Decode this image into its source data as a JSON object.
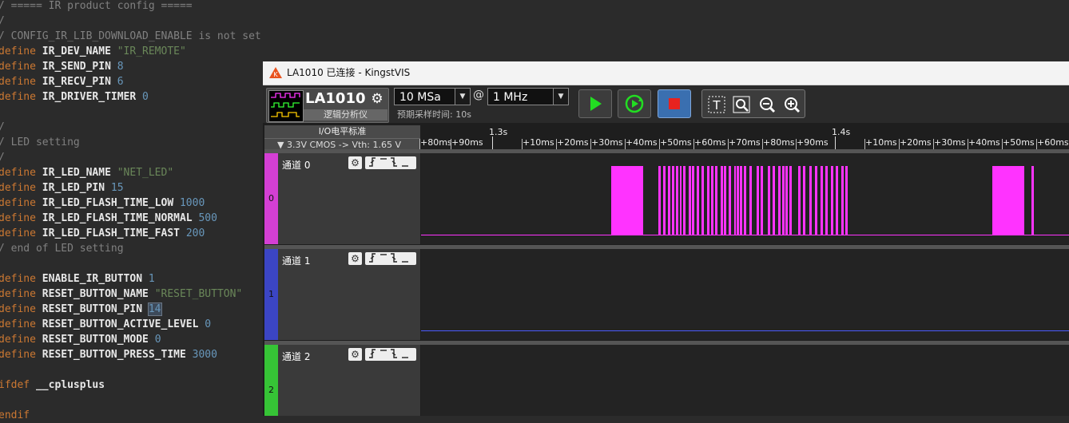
{
  "editor": {
    "lines": [
      [
        {
          "t": "/ ===== IR product config =====",
          "c": "cmt"
        }
      ],
      [
        {
          "t": "/",
          "c": "cmt"
        }
      ],
      [
        {
          "t": "/ CONFIG_IR_LIB_DOWNLOAD_ENABLE is not set",
          "c": "cmt"
        }
      ],
      [
        {
          "t": "define ",
          "c": "kw"
        },
        {
          "t": "IR_DEV_NAME ",
          "c": "id"
        },
        {
          "t": "\"IR_REMOTE\"",
          "c": "str"
        }
      ],
      [
        {
          "t": "define ",
          "c": "kw"
        },
        {
          "t": "IR_SEND_PIN ",
          "c": "id"
        },
        {
          "t": "8",
          "c": "num"
        }
      ],
      [
        {
          "t": "define ",
          "c": "kw"
        },
        {
          "t": "IR_RECV_PIN ",
          "c": "id"
        },
        {
          "t": "6",
          "c": "num"
        }
      ],
      [
        {
          "t": "define ",
          "c": "kw"
        },
        {
          "t": "IR_DRIVER_TIMER ",
          "c": "id"
        },
        {
          "t": "0",
          "c": "num"
        }
      ],
      [
        {
          "t": "",
          "c": "cmt"
        }
      ],
      [
        {
          "t": "/",
          "c": "cmt"
        }
      ],
      [
        {
          "t": "/ LED setting",
          "c": "cmt"
        }
      ],
      [
        {
          "t": "/",
          "c": "cmt"
        }
      ],
      [
        {
          "t": "define ",
          "c": "kw"
        },
        {
          "t": "IR_LED_NAME ",
          "c": "id"
        },
        {
          "t": "\"NET_LED\"",
          "c": "str"
        }
      ],
      [
        {
          "t": "define ",
          "c": "kw"
        },
        {
          "t": "IR_LED_PIN ",
          "c": "id"
        },
        {
          "t": "15",
          "c": "num"
        }
      ],
      [
        {
          "t": "define ",
          "c": "kw"
        },
        {
          "t": "IR_LED_FLASH_TIME_LOW ",
          "c": "id"
        },
        {
          "t": "1000",
          "c": "num"
        }
      ],
      [
        {
          "t": "define ",
          "c": "kw"
        },
        {
          "t": "IR_LED_FLASH_TIME_NORMAL ",
          "c": "id"
        },
        {
          "t": "500",
          "c": "num"
        }
      ],
      [
        {
          "t": "define ",
          "c": "kw"
        },
        {
          "t": "IR_LED_FLASH_TIME_FAST ",
          "c": "id"
        },
        {
          "t": "200",
          "c": "num"
        }
      ],
      [
        {
          "t": "/ end of LED setting",
          "c": "cmt"
        }
      ],
      [
        {
          "t": "",
          "c": "cmt"
        }
      ],
      [
        {
          "t": "define ",
          "c": "kw"
        },
        {
          "t": "ENABLE_IR_BUTTON ",
          "c": "id"
        },
        {
          "t": "1",
          "c": "num"
        }
      ],
      [
        {
          "t": "define ",
          "c": "kw"
        },
        {
          "t": "RESET_BUTTON_NAME ",
          "c": "id"
        },
        {
          "t": "\"RESET_BUTTON\"",
          "c": "str"
        }
      ],
      [
        {
          "t": "define ",
          "c": "kw"
        },
        {
          "t": "RESET_BUTTON_PIN ",
          "c": "id"
        },
        {
          "t": "14",
          "c": "curnum"
        }
      ],
      [
        {
          "t": "define ",
          "c": "kw"
        },
        {
          "t": "RESET_BUTTON_ACTIVE_LEVEL ",
          "c": "id"
        },
        {
          "t": "0",
          "c": "num"
        }
      ],
      [
        {
          "t": "define ",
          "c": "kw"
        },
        {
          "t": "RESET_BUTTON_MODE ",
          "c": "id"
        },
        {
          "t": "0",
          "c": "num"
        }
      ],
      [
        {
          "t": "define ",
          "c": "kw"
        },
        {
          "t": "RESET_BUTTON_PRESS_TIME ",
          "c": "id"
        },
        {
          "t": "3000",
          "c": "num"
        }
      ],
      [
        {
          "t": "",
          "c": "cmt"
        }
      ],
      [
        {
          "t": "ifdef ",
          "c": "kw"
        },
        {
          "t": "__cplusplus",
          "c": "id"
        }
      ],
      [
        {
          "t": "",
          "c": "cmt"
        }
      ],
      [
        {
          "t": "endif",
          "c": "kw"
        }
      ]
    ]
  },
  "window": {
    "title": "LA1010 已连接 - KingstVIS"
  },
  "toolbar": {
    "device_name": "LA1010",
    "device_sub": "逻辑分析仪",
    "sample_rate": "10 MSa",
    "at": "@",
    "sample_freq": "1 MHz",
    "preset_time": "预期采样时间: 10s"
  },
  "timeline": {
    "io_standard": "I/O电平标准",
    "voltage": "▼ 3.3V CMOS -> Vth: 1.65 V",
    "major_labels": [
      "1.3s",
      "1.4s"
    ],
    "tick_labels": [
      "+80ms",
      "+90ms",
      "+10ms",
      "+20ms",
      "+30ms",
      "+40ms",
      "+50ms",
      "+60ms",
      "+70ms",
      "+80ms",
      "+90ms",
      "+10ms",
      "+20ms",
      "+30ms",
      "+40ms",
      "+50ms",
      "+60ms"
    ]
  },
  "channels": [
    {
      "name": "通道 0",
      "index": "0",
      "color": "#d43fd4",
      "wave_color": "#ff33ff"
    },
    {
      "name": "通道 1",
      "index": "1",
      "color": "#3b45c4",
      "wave_color": "#4b5bff"
    },
    {
      "name": "通道 2",
      "index": "2",
      "color": "#36c436",
      "wave_color": "#33ff33"
    }
  ],
  "trigger_icons": "ʄ ̅ ̲ʈ ̲"
}
